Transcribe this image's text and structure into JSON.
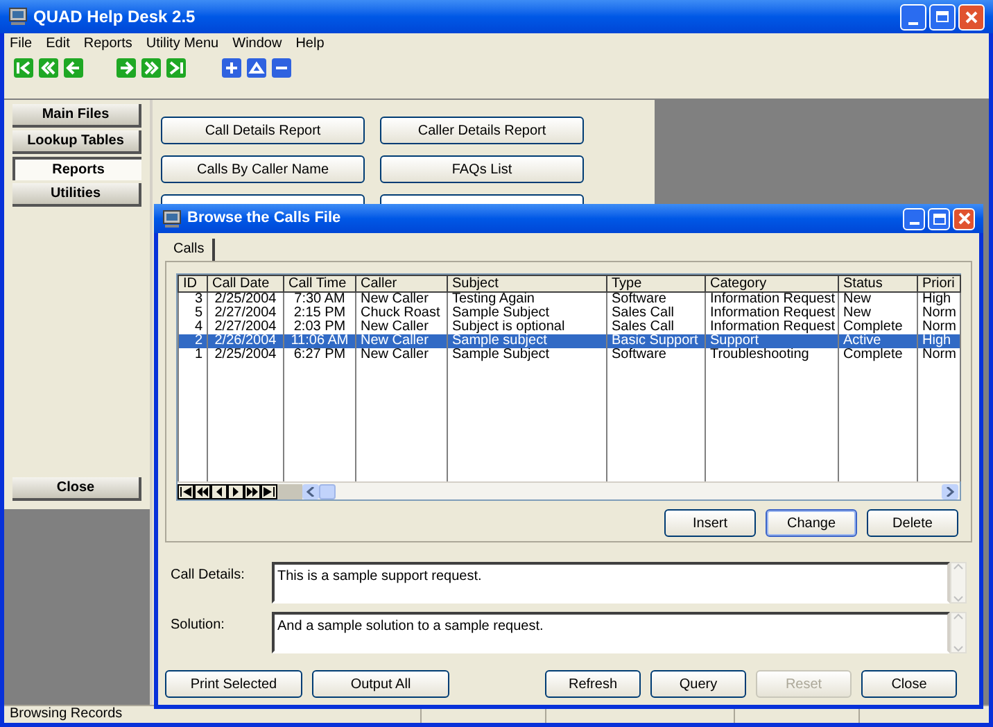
{
  "window": {
    "title": "QUAD Help Desk 2.5"
  },
  "menu": [
    "File",
    "Edit",
    "Reports",
    "Utility Menu",
    "Window",
    "Help"
  ],
  "sidebar": {
    "items": [
      {
        "label": "Main Files",
        "selected": false
      },
      {
        "label": "Lookup Tables",
        "selected": false
      },
      {
        "label": "Reports",
        "selected": true
      },
      {
        "label": "Utilities",
        "selected": false
      }
    ],
    "close_button": "Close"
  },
  "reports_panel": {
    "buttons": [
      "Call Details Report",
      "Caller Details Report",
      "Calls By Caller Name",
      "FAQs List"
    ]
  },
  "dialog": {
    "title": "Browse the Calls File",
    "tabs": [
      {
        "label": "Calls",
        "selected": true
      }
    ],
    "table": {
      "columns": [
        "ID",
        "Call Date",
        "Call Time",
        "Caller",
        "Subject",
        "Type",
        "Category",
        "Status",
        "Priori"
      ],
      "rows": [
        {
          "cells": [
            "3",
            "2/25/2004",
            "7:30 AM",
            "New Caller",
            "Testing Again",
            "Software",
            "Information Request",
            "New",
            "High"
          ],
          "selected": false
        },
        {
          "cells": [
            "5",
            "2/27/2004",
            "2:15 PM",
            "Chuck Roast",
            "Sample Subject",
            "Sales Call",
            "Information Request",
            "New",
            "Norm"
          ],
          "selected": false
        },
        {
          "cells": [
            "4",
            "2/27/2004",
            "2:03 PM",
            "New Caller",
            "Subject is optional",
            "Sales Call",
            "Information Request",
            "Complete",
            "Norm"
          ],
          "selected": false
        },
        {
          "cells": [
            "2",
            "2/26/2004",
            "11:06 AM",
            "New Caller",
            "Sample subject",
            "Basic Support",
            "Support",
            "Active",
            "High"
          ],
          "selected": true
        },
        {
          "cells": [
            "1",
            "2/25/2004",
            "6:27 PM",
            "New Caller",
            "Sample Subject",
            "Software",
            "Troubleshooting",
            "Complete",
            "Norm"
          ],
          "selected": false
        }
      ]
    },
    "grid_buttons": [
      {
        "label": "Insert",
        "focused": false
      },
      {
        "label": "Change",
        "focused": true
      },
      {
        "label": "Delete",
        "focused": false
      }
    ],
    "fields": [
      {
        "label": "Call Details:",
        "value": "This is a sample support request."
      },
      {
        "label": "Solution:",
        "value": "And a sample solution to a sample request."
      }
    ],
    "buttons": [
      {
        "label": "Print Selected",
        "disabled": false
      },
      {
        "label": "Output All",
        "disabled": false
      },
      {
        "label": "Refresh",
        "disabled": false
      },
      {
        "label": "Query",
        "disabled": false
      },
      {
        "label": "Reset",
        "disabled": true
      },
      {
        "label": "Close",
        "disabled": false
      }
    ]
  },
  "status_bar": "Browsing Records"
}
